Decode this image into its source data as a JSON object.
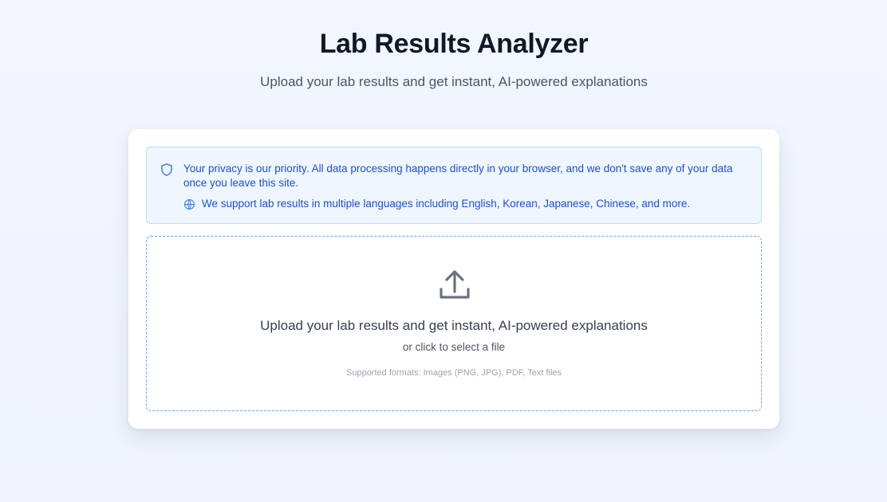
{
  "header": {
    "title": "Lab Results Analyzer",
    "subtitle": "Upload your lab results and get instant, AI-powered explanations"
  },
  "notice": {
    "privacy_text": "Your privacy is our priority. All data processing happens directly in your browser, and we don't save any of your data once you leave this site.",
    "languages_text": "We support lab results in multiple languages including English, Korean, Japanese, Chinese, and more.",
    "icons": [
      "shield-icon",
      "globe-icon"
    ]
  },
  "upload": {
    "title": "Upload your lab results and get instant, AI-powered explanations",
    "subtitle": "or click to select a file",
    "formats": "Supported formats: Images (PNG, JPG), PDF, Text files",
    "icon": "upload-icon"
  },
  "colors": {
    "accent": "#1d4ed8",
    "notice_bg": "#eff6ff",
    "notice_border": "#bfdbfe",
    "dropzone_border": "#60a5fa"
  }
}
